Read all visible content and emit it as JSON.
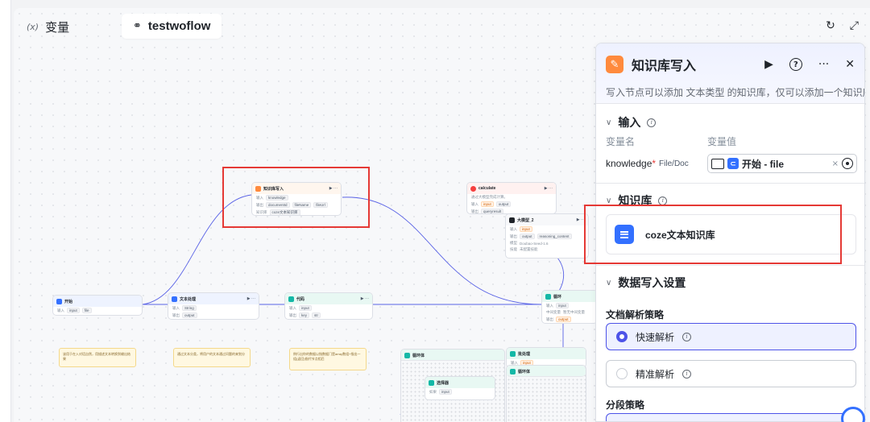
{
  "topbar": {
    "var_glyph": "(x)",
    "var_label": "变量",
    "workflow_tab_icon": "⚭",
    "workflow_tab_label": "testwoflow",
    "refresh_icon": "↻",
    "expand_icon": "⤢"
  },
  "canvas": {
    "nodes": {
      "kb_write": {
        "title": "知识库写入",
        "in_label": "输入",
        "in_chip": "knowledge",
        "out_label": "输出",
        "out_chips": [
          "documentId",
          "fileName",
          "fileUrl"
        ],
        "kb_label": "知识库",
        "kb_value": "coze文本知识库"
      },
      "calculate": {
        "title": "calculate",
        "desc": "通过大模型完成计算。",
        "in_label": "输入",
        "in_chips": [
          "input",
          "output"
        ],
        "out_label": "输出",
        "out_chip": "queryresult"
      },
      "llm": {
        "title": "大模型_2",
        "in_label": "输入",
        "in_chip": "input",
        "out_label": "输出",
        "out_chips": [
          "output",
          "reasoning_content"
        ],
        "model_label": "模型",
        "model_value": "Doubao-Seed-1.6",
        "skill_label": "技能",
        "skill_value": "未配置技能"
      },
      "start": {
        "title": "开始",
        "in_label": "输入",
        "in_chips": [
          "input",
          "file"
        ]
      },
      "text": {
        "title": "文本处理",
        "in_label": "输入",
        "in_chip": "String",
        "out_label": "输出",
        "out_chip": "output"
      },
      "code": {
        "title": "代码",
        "in_label": "输入",
        "in_chip": "input",
        "out_label": "输出",
        "out_chips": [
          "key",
          "str"
        ]
      },
      "loop": {
        "title": "循环",
        "in_label": "输入",
        "in_chip": "input",
        "var_label": "中间变量",
        "var_value": "暂无中间变量",
        "out_label": "输出",
        "out_chip": "output"
      },
      "loop_body": {
        "title": "循环体"
      },
      "batch": {
        "title": "批处理",
        "in_label": "输入",
        "in_chip": "input"
      },
      "batch_body": {
        "title": "循环体"
      },
      "select": {
        "title": "选择器",
        "cond_label": "如果",
        "cond_chip": "input"
      }
    },
    "notes": {
      "start": "该用于在入对话自然，用描述文本转换到输出结果",
      "text": "通过文本分类，将用户的文本通过问题的来划分",
      "code": "例行出你的数据以指数据门是array数组+指出一组(返回)指代节点相匹"
    }
  },
  "panel": {
    "title": "知识库写入",
    "run_icon": "▶",
    "help_icon": "?",
    "more_icon": "···",
    "close_icon": "✕",
    "description": "写入节点可以添加 文本类型 的知识库，仅可以添加一个知识库",
    "input_section": "输入",
    "col_var_name": "变量名",
    "col_var_value": "变量值",
    "param_name": "knowledge",
    "param_required": "*",
    "param_type": "File/Doc",
    "value_source_icon": "⊂",
    "value_text": "开始 - file",
    "clear_icon": "×",
    "kb_section": "知识库",
    "kb_name": "coze文本知识库",
    "write_section": "数据写入设置",
    "parse_label": "文档解析策略",
    "parse_fast": "快速解析",
    "parse_precise": "精准解析",
    "segment_label": "分段策略",
    "info_glyph": "i",
    "chevron": "∨"
  },
  "colors": {
    "accent": "#4d53e8",
    "node_orange": "#ff8a3d",
    "kb_blue": "#3370ff",
    "highlight_red": "#e53935",
    "edge": "#5a63e6"
  }
}
